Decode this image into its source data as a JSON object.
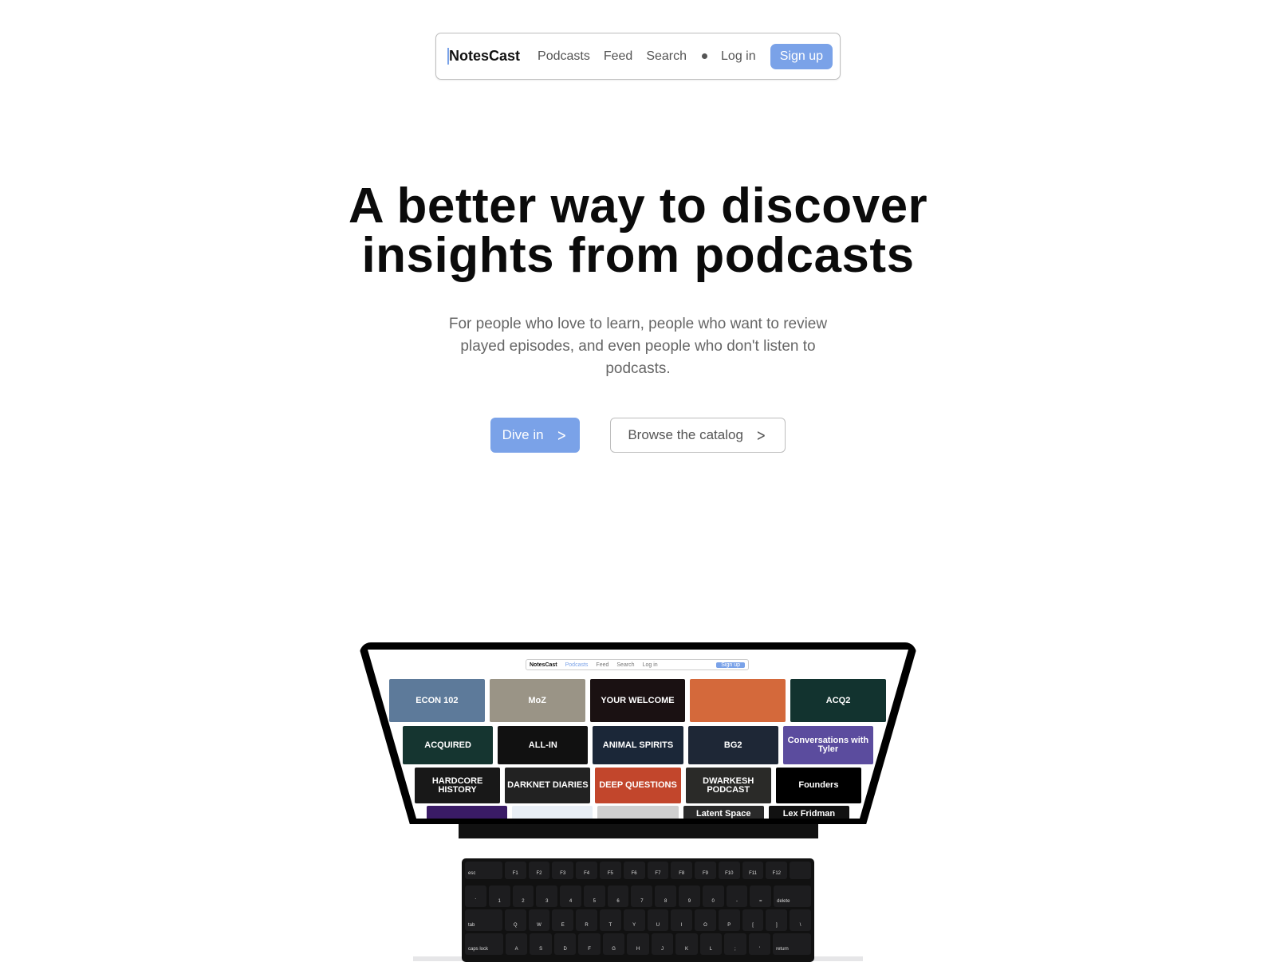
{
  "nav": {
    "logo": "NotesCast",
    "links": [
      "Podcasts",
      "Feed",
      "Search"
    ],
    "login": "Log in",
    "signup": "Sign up"
  },
  "hero": {
    "title_line1": "A better way to discover",
    "title_line2": "insights from podcasts",
    "subtitle": "For people who love to learn, people who want to review played episodes, and even people who don't listen to podcasts.",
    "primary_cta": "Dive in",
    "secondary_cta": "Browse the catalog"
  },
  "colors": {
    "accent": "#7aa2e8",
    "text": "#0b0b0b",
    "muted": "#666666"
  },
  "laptop": {
    "mini_nav": {
      "logo": "NotesCast",
      "links": [
        "Podcasts",
        "Feed",
        "Search",
        "Log in"
      ],
      "signup": "Sign up"
    },
    "rows": [
      [
        {
          "t": "ECON 102",
          "c": "#5d7a9a"
        },
        {
          "t": "MoZ",
          "c": "#9a9486"
        },
        {
          "t": "YOUR WELCOME",
          "c": "#1a1112"
        },
        {
          "t": "",
          "c": "#d4693b"
        },
        {
          "t": "ACQ2",
          "c": "#12332f"
        }
      ],
      [
        {
          "t": "ACQUIRED",
          "c": "#153530"
        },
        {
          "t": "ALL-IN",
          "c": "#111"
        },
        {
          "t": "ANIMAL SPIRITS",
          "c": "#1b2738"
        },
        {
          "t": "BG2",
          "c": "#1e2736"
        },
        {
          "t": "Conversations with Tyler",
          "c": "#5b4c9e"
        }
      ],
      [
        {
          "t": "HARDCORE HISTORY",
          "c": "#181818"
        },
        {
          "t": "DARKNET DIARIES",
          "c": "#222"
        },
        {
          "t": "DEEP QUESTIONS",
          "c": "#c2462c"
        },
        {
          "t": "DWARKESH PODCAST",
          "c": "#2a2a28"
        },
        {
          "t": "Founders",
          "c": "#000"
        }
      ],
      [
        {
          "t": "",
          "c": "#3a1b66"
        },
        {
          "t": "",
          "c": "#e8eef5"
        },
        {
          "t": "",
          "c": "#cfcfcf"
        },
        {
          "t": "Latent Space",
          "c": "#2a2a2a"
        },
        {
          "t": "Lex Fridman",
          "c": "#111"
        }
      ]
    ],
    "keyboard": [
      [
        "esc",
        "F1",
        "F2",
        "F3",
        "F4",
        "F5",
        "F6",
        "F7",
        "F8",
        "F9",
        "F10",
        "F11",
        "F12",
        ""
      ],
      [
        "`",
        "1",
        "2",
        "3",
        "4",
        "5",
        "6",
        "7",
        "8",
        "9",
        "0",
        "-",
        "=",
        "delete"
      ],
      [
        "tab",
        "Q",
        "W",
        "E",
        "R",
        "T",
        "Y",
        "U",
        "I",
        "O",
        "P",
        "[",
        "]",
        "\\"
      ],
      [
        "caps lock",
        "A",
        "S",
        "D",
        "F",
        "G",
        "H",
        "J",
        "K",
        "L",
        ";",
        "'",
        "return"
      ]
    ]
  }
}
